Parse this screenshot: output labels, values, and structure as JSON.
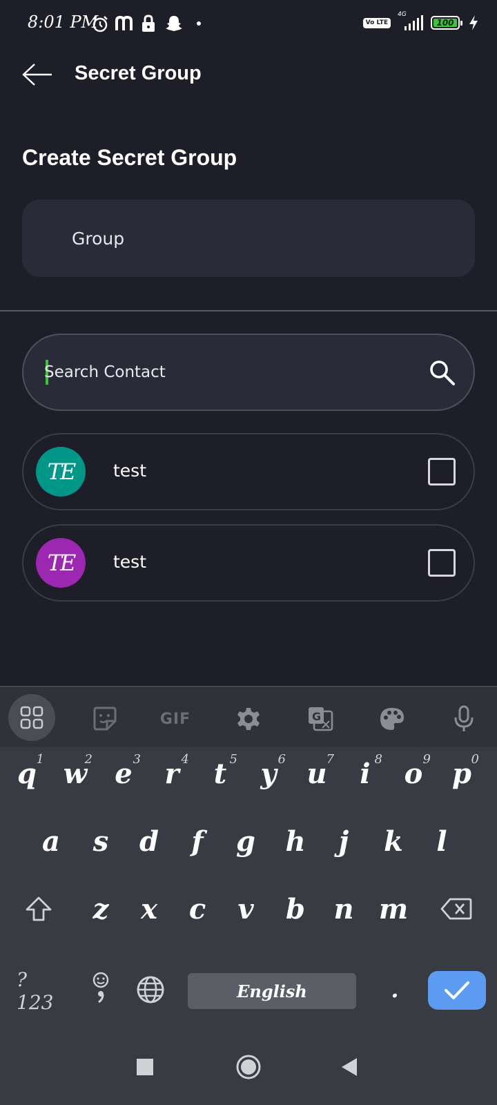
{
  "status_bar": {
    "time": "8:01 PM",
    "network": "4G",
    "volte": "Vo LTE",
    "battery": "100",
    "icons": [
      "alarm-icon",
      "m-app-icon",
      "lock-icon",
      "snapchat-icon",
      "dot-icon",
      "signal-icon",
      "charging-icon"
    ]
  },
  "header": {
    "title": "Secret Group",
    "back_icon": "arrow-left-icon"
  },
  "form": {
    "section_title": "Create Secret Group",
    "group_name_placeholder": "Group",
    "search_placeholder": "Search Contact"
  },
  "contacts": [
    {
      "initials": "TE",
      "name": "test",
      "color": "#009688",
      "checked": false
    },
    {
      "initials": "TE",
      "name": "test",
      "color": "#9c27b0",
      "checked": false
    }
  ],
  "keyboard": {
    "toolbar": [
      "apps-icon",
      "sticker-icon",
      "GIF",
      "gear-icon",
      "translate-icon",
      "palette-icon",
      "mic-icon"
    ],
    "gif_label": "GIF",
    "row1": [
      {
        "k": "q",
        "h": "1"
      },
      {
        "k": "w",
        "h": "2"
      },
      {
        "k": "e",
        "h": "3"
      },
      {
        "k": "r",
        "h": "4"
      },
      {
        "k": "t",
        "h": "5"
      },
      {
        "k": "y",
        "h": "6"
      },
      {
        "k": "u",
        "h": "7"
      },
      {
        "k": "i",
        "h": "8"
      },
      {
        "k": "o",
        "h": "9"
      },
      {
        "k": "p",
        "h": "0"
      }
    ],
    "row2": [
      "a",
      "s",
      "d",
      "f",
      "g",
      "h",
      "j",
      "k",
      "l"
    ],
    "row3": [
      "z",
      "x",
      "c",
      "v",
      "b",
      "n",
      "m"
    ],
    "symbols_label": "?123",
    "space_label": "English",
    "period_label": "."
  },
  "colors": {
    "background": "#1d1e27",
    "field": "#2a2b38",
    "accent_caret": "#3ec43a",
    "enter_key": "#5b9cf2"
  }
}
